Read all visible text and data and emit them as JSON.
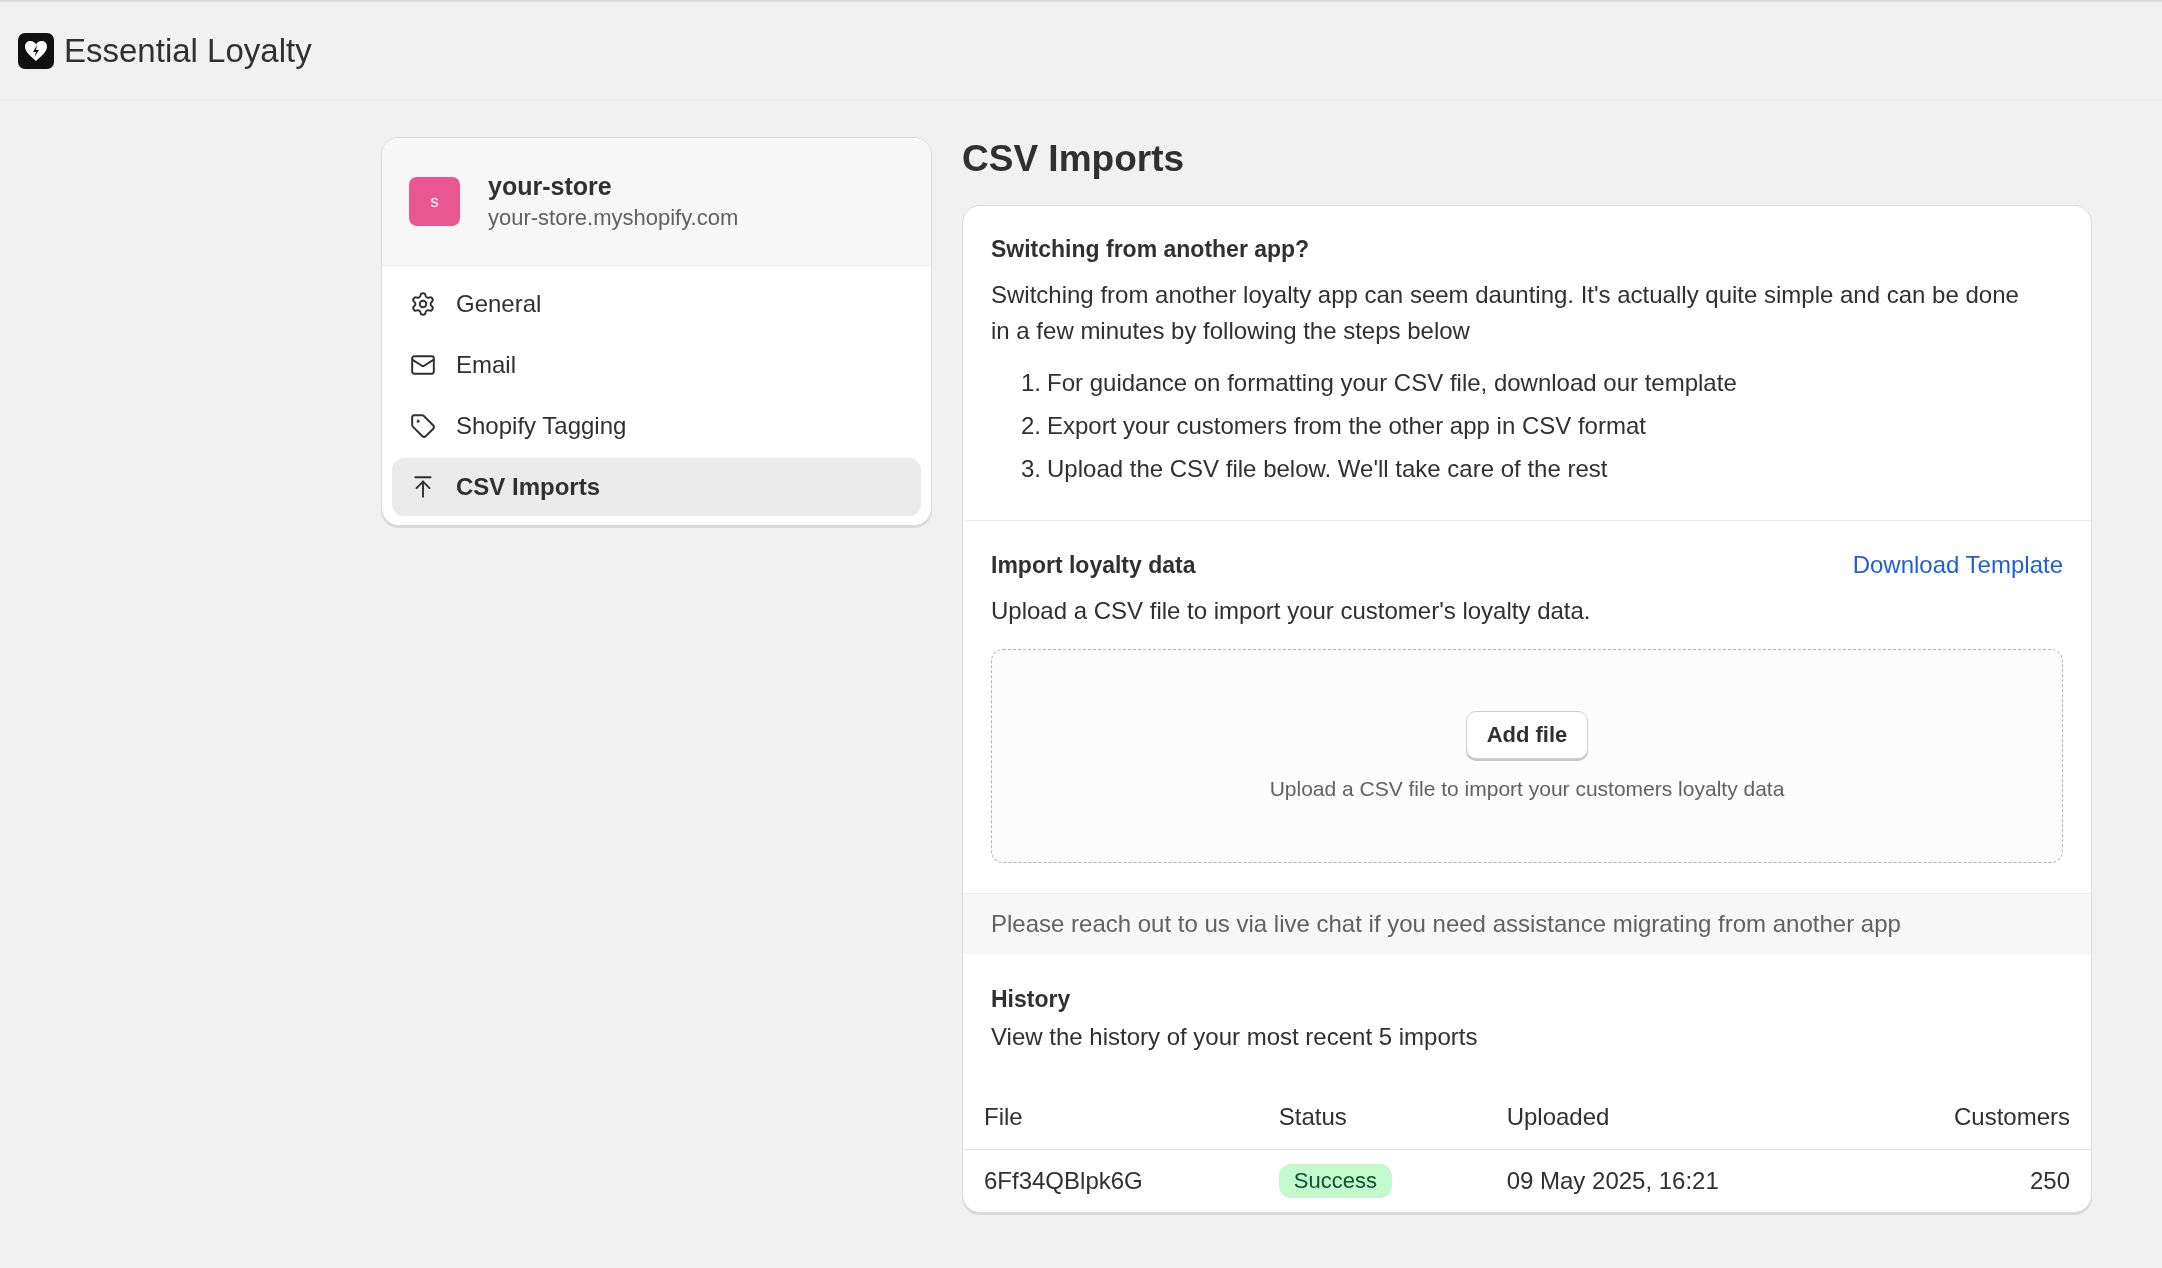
{
  "app": {
    "title": "Essential Loyalty"
  },
  "store": {
    "initial": "s",
    "name": "your-store",
    "domain": "your-store.myshopify.com"
  },
  "nav": [
    {
      "label": "General",
      "selected": false
    },
    {
      "label": "Email",
      "selected": false
    },
    {
      "label": "Shopify Tagging",
      "selected": false
    },
    {
      "label": "CSV Imports",
      "selected": true
    }
  ],
  "page_title": "CSV Imports",
  "switching": {
    "heading": "Switching from another app?",
    "body": "Switching from another loyalty app can seem daunting. It's actually quite simple and can be done in a few minutes by following the steps below",
    "steps": [
      {
        "marker": "1.",
        "text": "For guidance on formatting your CSV file, download our template"
      },
      {
        "marker": "2.",
        "text": "Export your customers from the other app in CSV format"
      },
      {
        "marker": "3.",
        "text": "Upload the CSV file below. We'll take care of the rest"
      }
    ]
  },
  "import": {
    "heading": "Import loyalty data",
    "link": "Download Template",
    "description": "Upload a CSV file to import your customer's loyalty data.",
    "button": "Add file",
    "hint": "Upload a CSV file to import your customers loyalty data"
  },
  "note": "Please reach out to us via live chat if you need assistance migrating from another app",
  "history": {
    "heading": "History",
    "description": "View the history of your most recent 5 imports",
    "columns": [
      "File",
      "Status",
      "Uploaded",
      "Customers"
    ],
    "rows": [
      {
        "file": "6Ff34QBlpk6G",
        "status": {
          "label": "Success",
          "kind": "success"
        },
        "uploaded": "09 May 2025, 16:21",
        "customers": "250"
      }
    ]
  }
}
